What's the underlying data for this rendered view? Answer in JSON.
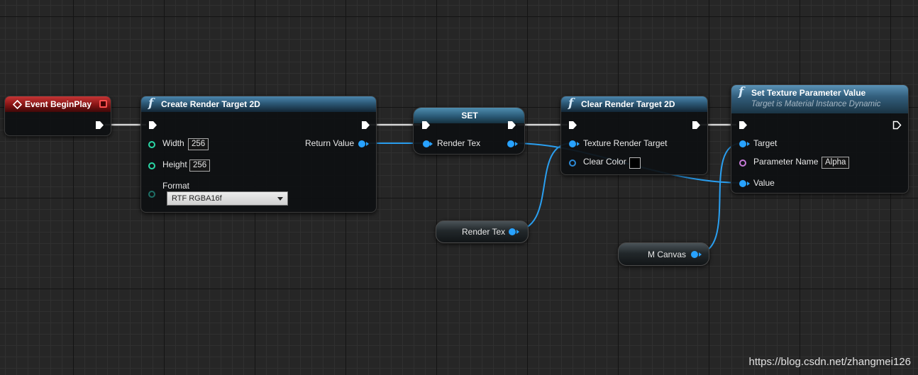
{
  "nodes": {
    "event_begin_play": {
      "title": "Event BeginPlay"
    },
    "create_render_target": {
      "title": "Create Render Target 2D",
      "width_label": "Width",
      "width_value": "256",
      "height_label": "Height",
      "height_value": "256",
      "format_label": "Format",
      "format_value": "RTF RGBA16f",
      "return_label": "Return Value"
    },
    "set_node": {
      "title": "SET",
      "input_label": "Render Tex"
    },
    "clear_render_target": {
      "title": "Clear Render Target 2D",
      "texture_label": "Texture Render Target",
      "color_label": "Clear Color"
    },
    "set_texture_param": {
      "title": "Set Texture Parameter Value",
      "subtitle": "Target is Material Instance Dynamic",
      "target_label": "Target",
      "param_label": "Parameter Name",
      "param_value": "Alpha",
      "value_label": "Value"
    },
    "render_tex_getter": {
      "label": "Render Tex"
    },
    "m_canvas_getter": {
      "label": "M Canvas"
    }
  },
  "watermark": "https://blog.csdn.net/zhangmei126",
  "colors": {
    "grid_background": "#262626",
    "event_header": "#a01f1f",
    "function_header": "#2c5876",
    "object_pin": "#28a2ff",
    "integer_pin": "#2ad8a6",
    "name_pin": "#c77bd8",
    "exec_pin": "#ffffff"
  }
}
